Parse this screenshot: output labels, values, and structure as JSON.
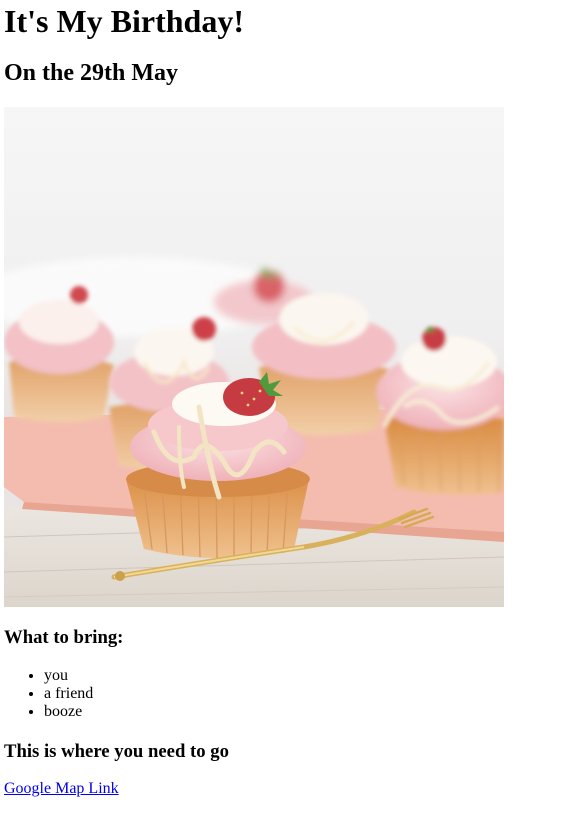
{
  "page": {
    "heading": "It's My Birthday!",
    "date_heading": "On the 29th May"
  },
  "image": {
    "alt": "Strawberry cupcakes with pink frosting and white chocolate drizzle"
  },
  "bring": {
    "heading": "What to bring:",
    "items": [
      "you",
      "a friend",
      "booze"
    ]
  },
  "location": {
    "heading": "This is where you need to go",
    "link_label": "Google Map Link"
  },
  "colors": {
    "link": "#0000ee",
    "frosting": "#f2b5bb",
    "cake": "#e2a15a",
    "tray": "#f3b9ab"
  }
}
